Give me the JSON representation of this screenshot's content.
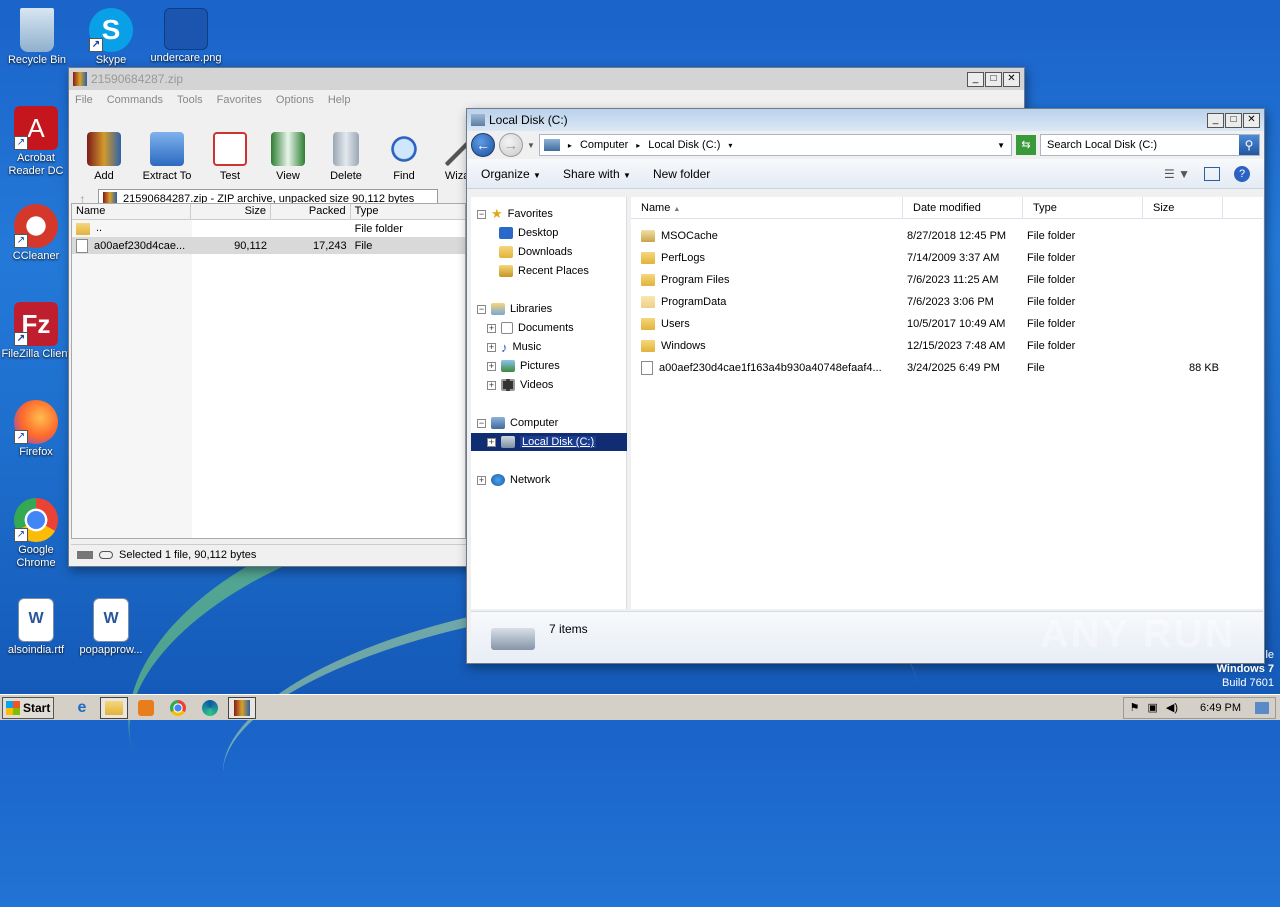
{
  "desktop": {
    "icons": [
      {
        "label": "Recycle Bin"
      },
      {
        "label": "Skype"
      },
      {
        "label": "undercare.png"
      },
      {
        "label": "Acrobat Reader DC"
      },
      {
        "label": "CCleaner"
      },
      {
        "label": "FileZilla Client"
      },
      {
        "label": "Firefox"
      },
      {
        "label": "Google Chrome"
      },
      {
        "label": "alsoindia.rtf"
      },
      {
        "label": "popapprow..."
      }
    ],
    "watermark": "ANY RUN",
    "windows_edition": "le",
    "windows_name": "Windows 7",
    "windows_build": "Build 7601"
  },
  "winrar": {
    "title": "21590684287.zip",
    "menu": [
      "File",
      "Commands",
      "Tools",
      "Favorites",
      "Options",
      "Help"
    ],
    "toolbar": [
      "Add",
      "Extract To",
      "Test",
      "View",
      "Delete",
      "Find",
      "Wizard"
    ],
    "address": "21590684287.zip - ZIP archive, unpacked size 90,112 bytes",
    "columns": [
      "Name",
      "Size",
      "Packed",
      "Type"
    ],
    "rows": [
      {
        "name": "..",
        "size": "",
        "packed": "",
        "type": "File folder"
      },
      {
        "name": "a00aef230d4cae...",
        "size": "90,112",
        "packed": "17,243",
        "type": "File"
      }
    ],
    "status": "Selected 1 file, 90,112 bytes"
  },
  "explorer": {
    "title": "Local Disk (C:)",
    "breadcrumb": [
      "Computer",
      "Local Disk (C:)"
    ],
    "search_placeholder": "Search Local Disk (C:)",
    "commands": [
      "Organize",
      "Share with",
      "New folder"
    ],
    "nav": {
      "favorites": "Favorites",
      "desktop": "Desktop",
      "downloads": "Downloads",
      "recent": "Recent Places",
      "libraries": "Libraries",
      "documents": "Documents",
      "music": "Music",
      "pictures": "Pictures",
      "videos": "Videos",
      "computer": "Computer",
      "localdisk": "Local Disk (C:)",
      "network": "Network"
    },
    "columns": [
      "Name",
      "Date modified",
      "Type",
      "Size"
    ],
    "files": [
      {
        "name": "MSOCache",
        "date": "8/27/2018 12:45 PM",
        "type": "File folder",
        "size": "",
        "kind": "lock"
      },
      {
        "name": "PerfLogs",
        "date": "7/14/2009 3:37 AM",
        "type": "File folder",
        "size": "",
        "kind": "folder"
      },
      {
        "name": "Program Files",
        "date": "7/6/2023 11:25 AM",
        "type": "File folder",
        "size": "",
        "kind": "folder"
      },
      {
        "name": "ProgramData",
        "date": "7/6/2023 3:06 PM",
        "type": "File folder",
        "size": "",
        "kind": "folder"
      },
      {
        "name": "Users",
        "date": "10/5/2017 10:49 AM",
        "type": "File folder",
        "size": "",
        "kind": "folder"
      },
      {
        "name": "Windows",
        "date": "12/15/2023 7:48 AM",
        "type": "File folder",
        "size": "",
        "kind": "folder"
      },
      {
        "name": "a00aef230d4cae1f163a4b930a40748efaaf4...",
        "date": "3/24/2025 6:49 PM",
        "type": "File",
        "size": "88 KB",
        "kind": "file"
      }
    ],
    "item_count": "7 items"
  },
  "taskbar": {
    "start_label": "Start",
    "clock": "6:49 PM"
  }
}
